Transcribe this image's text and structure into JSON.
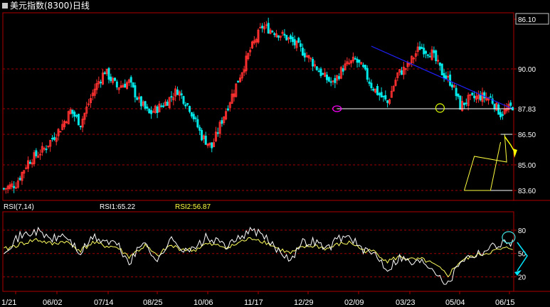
{
  "title": "美元指数(8300)日线",
  "chart_data": {
    "type": "candlestick",
    "title": "美元指数(8300)日线",
    "price_axis": {
      "ylim": [
        83.0,
        86.3
      ],
      "ticks": [
        "86.10",
        "90.00",
        "87.83",
        "86.50",
        "85.00",
        "83.60"
      ]
    },
    "x_tick_labels": [
      "1/21",
      "06/02",
      "07/14",
      "08/25",
      "10/06",
      "11/17",
      "12/29",
      "02/09",
      "03/23",
      "05/04",
      "06/15"
    ],
    "price_path": [
      [
        0,
        83.1
      ],
      [
        6,
        83.4
      ],
      [
        12,
        84.8
      ],
      [
        20,
        85.6
      ],
      [
        28,
        86.9
      ],
      [
        33,
        88.0
      ],
      [
        38,
        87.2
      ],
      [
        45,
        89.4
      ],
      [
        50,
        90.5
      ],
      [
        56,
        89.5
      ],
      [
        62,
        89.8
      ],
      [
        67,
        88.6
      ],
      [
        72,
        87.8
      ],
      [
        80,
        88.5
      ],
      [
        86,
        89.3
      ],
      [
        92,
        88.2
      ],
      [
        98,
        86.4
      ],
      [
        103,
        85.7
      ],
      [
        108,
        87.4
      ],
      [
        115,
        89.6
      ],
      [
        122,
        91.8
      ],
      [
        128,
        93.3
      ],
      [
        134,
        93.0
      ],
      [
        140,
        92.6
      ],
      [
        146,
        92.0
      ],
      [
        152,
        91.2
      ],
      [
        158,
        90.2
      ],
      [
        163,
        89.7
      ],
      [
        168,
        90.7
      ],
      [
        174,
        91.2
      ],
      [
        178,
        90.6
      ],
      [
        182,
        89.6
      ],
      [
        186,
        89.0
      ],
      [
        190,
        88.5
      ],
      [
        195,
        90.3
      ],
      [
        200,
        90.8
      ],
      [
        206,
        92.0
      ],
      [
        212,
        91.6
      ],
      [
        217,
        90.4
      ],
      [
        222,
        89.7
      ],
      [
        226,
        88.3
      ],
      [
        230,
        88.7
      ],
      [
        236,
        88.9
      ],
      [
        241,
        88.8
      ],
      [
        246,
        87.8
      ],
      [
        252,
        88.3
      ]
    ],
    "rsi": {
      "name": "RSI(7,14)",
      "rsi1_label": "RSI1:65.22",
      "rsi2_label": "RSI2:56.87",
      "levels": [
        80,
        50,
        20
      ],
      "ylim": [
        5,
        100
      ],
      "rsi1_path": [
        [
          0,
          55
        ],
        [
          8,
          72
        ],
        [
          16,
          79
        ],
        [
          24,
          68
        ],
        [
          30,
          74
        ],
        [
          38,
          50
        ],
        [
          44,
          71
        ],
        [
          50,
          66
        ],
        [
          56,
          62
        ],
        [
          62,
          38
        ],
        [
          70,
          67
        ],
        [
          76,
          38
        ],
        [
          82,
          68
        ],
        [
          88,
          58
        ],
        [
          94,
          54
        ],
        [
          100,
          70
        ],
        [
          106,
          64
        ],
        [
          112,
          60
        ],
        [
          118,
          74
        ],
        [
          124,
          80
        ],
        [
          130,
          68
        ],
        [
          136,
          54
        ],
        [
          142,
          44
        ],
        [
          148,
          64
        ],
        [
          154,
          66
        ],
        [
          160,
          56
        ],
        [
          166,
          70
        ],
        [
          172,
          72
        ],
        [
          178,
          52
        ],
        [
          184,
          50
        ],
        [
          190,
          30
        ],
        [
          196,
          46
        ],
        [
          202,
          38
        ],
        [
          208,
          40
        ],
        [
          214,
          28
        ],
        [
          220,
          10
        ],
        [
          226,
          42
        ],
        [
          232,
          48
        ],
        [
          238,
          54
        ],
        [
          244,
          62
        ],
        [
          250,
          65
        ]
      ],
      "rsi2_path": [
        [
          0,
          55
        ],
        [
          8,
          62
        ],
        [
          16,
          68
        ],
        [
          24,
          62
        ],
        [
          30,
          66
        ],
        [
          38,
          54
        ],
        [
          44,
          64
        ],
        [
          50,
          60
        ],
        [
          56,
          58
        ],
        [
          62,
          46
        ],
        [
          70,
          60
        ],
        [
          76,
          46
        ],
        [
          82,
          60
        ],
        [
          88,
          56
        ],
        [
          94,
          54
        ],
        [
          100,
          62
        ],
        [
          106,
          60
        ],
        [
          112,
          58
        ],
        [
          118,
          66
        ],
        [
          124,
          70
        ],
        [
          130,
          64
        ],
        [
          136,
          56
        ],
        [
          142,
          50
        ],
        [
          148,
          58
        ],
        [
          154,
          60
        ],
        [
          160,
          56
        ],
        [
          166,
          62
        ],
        [
          172,
          64
        ],
        [
          178,
          54
        ],
        [
          184,
          52
        ],
        [
          190,
          40
        ],
        [
          196,
          46
        ],
        [
          202,
          42
        ],
        [
          208,
          42
        ],
        [
          214,
          34
        ],
        [
          220,
          22
        ],
        [
          226,
          40
        ],
        [
          232,
          46
        ],
        [
          238,
          50
        ],
        [
          244,
          54
        ],
        [
          250,
          57
        ]
      ]
    }
  }
}
